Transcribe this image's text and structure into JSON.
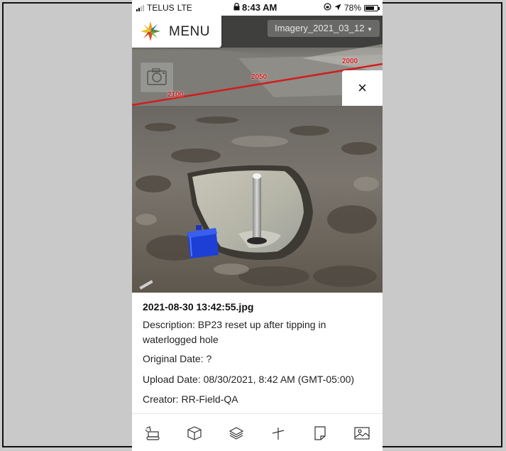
{
  "status_bar": {
    "carrier": "TELUS",
    "network": "LTE",
    "time": "8:43 AM",
    "battery": "78%",
    "battery_level": 0.78
  },
  "map": {
    "menu_label": "MENU",
    "imagery_select": "Imagery_2021_03_12",
    "contour_labels": [
      "2100",
      "2050",
      "2000"
    ],
    "contour_color": "#d21c1c",
    "close_label": "×"
  },
  "photo": {
    "filename": "2021-08-30 13:42:55.jpg",
    "description": "Description: BP23 reset up after tipping in waterlogged hole",
    "original_date": "Original Date: ?",
    "upload_date": "Upload Date: 08/30/2021, 8:42 AM (GMT-05:00)",
    "creator": "Creator: RR-Field-QA"
  },
  "toolbar": {
    "icons": [
      "excavator-icon",
      "cube-icon",
      "layers-icon",
      "measure-icon",
      "note-icon",
      "image-icon"
    ]
  }
}
